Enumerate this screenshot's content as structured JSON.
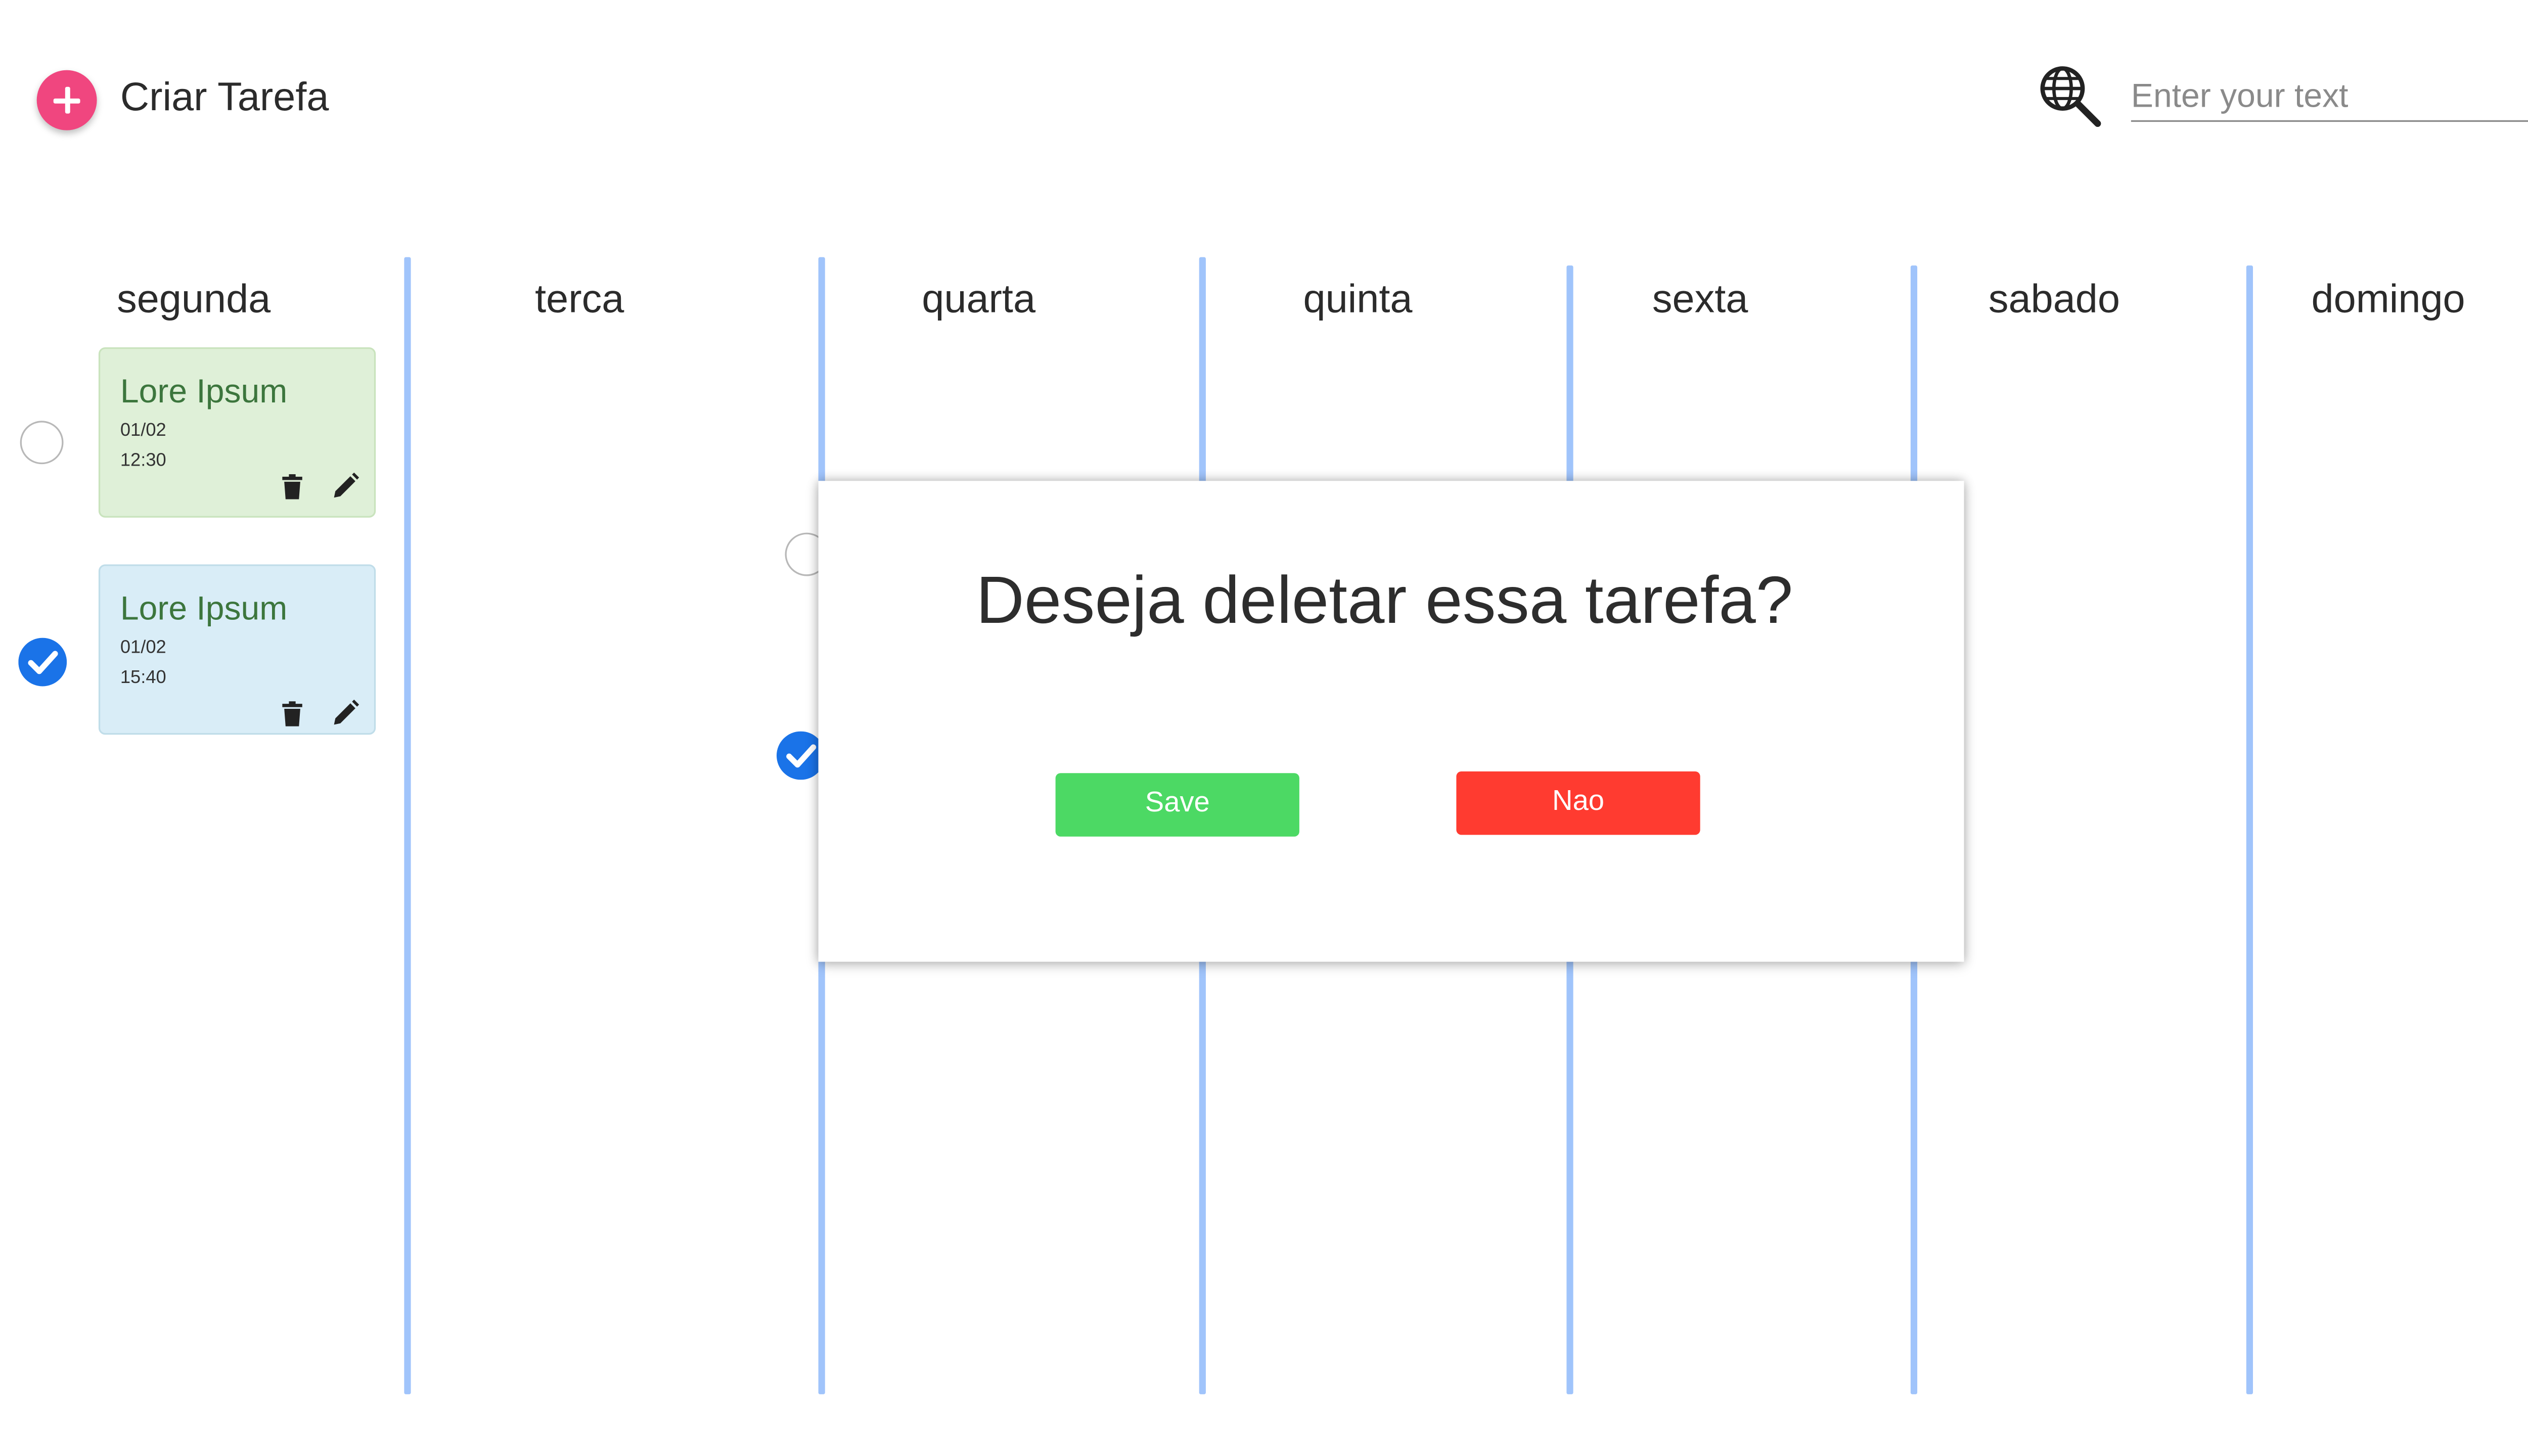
{
  "header": {
    "add_task_label": "Criar Tarefa",
    "search_placeholder": "Enter your text"
  },
  "days": [
    "segunda",
    "terca",
    "quarta",
    "quinta",
    "sexta",
    "sabado",
    "domingo"
  ],
  "tasks": [
    {
      "title": "Lore Ipsum",
      "date": "01/02",
      "time": "12:30",
      "completed": false,
      "color": "#dff0d8"
    },
    {
      "title": "Lore Ipsum",
      "date": "01/02",
      "time": "15:40",
      "completed": true,
      "color": "#d9edf7"
    }
  ],
  "dialog": {
    "question": "Deseja deletar essa tarefa?",
    "confirm_label": "Save",
    "cancel_label": "Nao"
  },
  "colors": {
    "accent_add": "#f0467f",
    "divider": "#a0c4fb",
    "check": "#1a73e8",
    "confirm": "#4cd964",
    "cancel": "#ff3b30"
  },
  "icons": [
    "plus-icon",
    "globe-search-icon",
    "trash-icon",
    "pencil-icon",
    "check-icon"
  ]
}
